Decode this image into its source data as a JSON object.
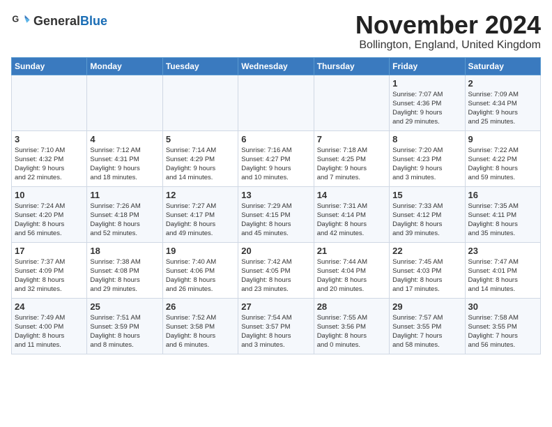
{
  "logo": {
    "general": "General",
    "blue": "Blue"
  },
  "title": "November 2024",
  "location": "Bollington, England, United Kingdom",
  "weekdays": [
    "Sunday",
    "Monday",
    "Tuesday",
    "Wednesday",
    "Thursday",
    "Friday",
    "Saturday"
  ],
  "rows": [
    [
      {
        "day": "",
        "detail": ""
      },
      {
        "day": "",
        "detail": ""
      },
      {
        "day": "",
        "detail": ""
      },
      {
        "day": "",
        "detail": ""
      },
      {
        "day": "",
        "detail": ""
      },
      {
        "day": "1",
        "detail": "Sunrise: 7:07 AM\nSunset: 4:36 PM\nDaylight: 9 hours\nand 29 minutes."
      },
      {
        "day": "2",
        "detail": "Sunrise: 7:09 AM\nSunset: 4:34 PM\nDaylight: 9 hours\nand 25 minutes."
      }
    ],
    [
      {
        "day": "3",
        "detail": "Sunrise: 7:10 AM\nSunset: 4:32 PM\nDaylight: 9 hours\nand 22 minutes."
      },
      {
        "day": "4",
        "detail": "Sunrise: 7:12 AM\nSunset: 4:31 PM\nDaylight: 9 hours\nand 18 minutes."
      },
      {
        "day": "5",
        "detail": "Sunrise: 7:14 AM\nSunset: 4:29 PM\nDaylight: 9 hours\nand 14 minutes."
      },
      {
        "day": "6",
        "detail": "Sunrise: 7:16 AM\nSunset: 4:27 PM\nDaylight: 9 hours\nand 10 minutes."
      },
      {
        "day": "7",
        "detail": "Sunrise: 7:18 AM\nSunset: 4:25 PM\nDaylight: 9 hours\nand 7 minutes."
      },
      {
        "day": "8",
        "detail": "Sunrise: 7:20 AM\nSunset: 4:23 PM\nDaylight: 9 hours\nand 3 minutes."
      },
      {
        "day": "9",
        "detail": "Sunrise: 7:22 AM\nSunset: 4:22 PM\nDaylight: 8 hours\nand 59 minutes."
      }
    ],
    [
      {
        "day": "10",
        "detail": "Sunrise: 7:24 AM\nSunset: 4:20 PM\nDaylight: 8 hours\nand 56 minutes."
      },
      {
        "day": "11",
        "detail": "Sunrise: 7:26 AM\nSunset: 4:18 PM\nDaylight: 8 hours\nand 52 minutes."
      },
      {
        "day": "12",
        "detail": "Sunrise: 7:27 AM\nSunset: 4:17 PM\nDaylight: 8 hours\nand 49 minutes."
      },
      {
        "day": "13",
        "detail": "Sunrise: 7:29 AM\nSunset: 4:15 PM\nDaylight: 8 hours\nand 45 minutes."
      },
      {
        "day": "14",
        "detail": "Sunrise: 7:31 AM\nSunset: 4:14 PM\nDaylight: 8 hours\nand 42 minutes."
      },
      {
        "day": "15",
        "detail": "Sunrise: 7:33 AM\nSunset: 4:12 PM\nDaylight: 8 hours\nand 39 minutes."
      },
      {
        "day": "16",
        "detail": "Sunrise: 7:35 AM\nSunset: 4:11 PM\nDaylight: 8 hours\nand 35 minutes."
      }
    ],
    [
      {
        "day": "17",
        "detail": "Sunrise: 7:37 AM\nSunset: 4:09 PM\nDaylight: 8 hours\nand 32 minutes."
      },
      {
        "day": "18",
        "detail": "Sunrise: 7:38 AM\nSunset: 4:08 PM\nDaylight: 8 hours\nand 29 minutes."
      },
      {
        "day": "19",
        "detail": "Sunrise: 7:40 AM\nSunset: 4:06 PM\nDaylight: 8 hours\nand 26 minutes."
      },
      {
        "day": "20",
        "detail": "Sunrise: 7:42 AM\nSunset: 4:05 PM\nDaylight: 8 hours\nand 23 minutes."
      },
      {
        "day": "21",
        "detail": "Sunrise: 7:44 AM\nSunset: 4:04 PM\nDaylight: 8 hours\nand 20 minutes."
      },
      {
        "day": "22",
        "detail": "Sunrise: 7:45 AM\nSunset: 4:03 PM\nDaylight: 8 hours\nand 17 minutes."
      },
      {
        "day": "23",
        "detail": "Sunrise: 7:47 AM\nSunset: 4:01 PM\nDaylight: 8 hours\nand 14 minutes."
      }
    ],
    [
      {
        "day": "24",
        "detail": "Sunrise: 7:49 AM\nSunset: 4:00 PM\nDaylight: 8 hours\nand 11 minutes."
      },
      {
        "day": "25",
        "detail": "Sunrise: 7:51 AM\nSunset: 3:59 PM\nDaylight: 8 hours\nand 8 minutes."
      },
      {
        "day": "26",
        "detail": "Sunrise: 7:52 AM\nSunset: 3:58 PM\nDaylight: 8 hours\nand 6 minutes."
      },
      {
        "day": "27",
        "detail": "Sunrise: 7:54 AM\nSunset: 3:57 PM\nDaylight: 8 hours\nand 3 minutes."
      },
      {
        "day": "28",
        "detail": "Sunrise: 7:55 AM\nSunset: 3:56 PM\nDaylight: 8 hours\nand 0 minutes."
      },
      {
        "day": "29",
        "detail": "Sunrise: 7:57 AM\nSunset: 3:55 PM\nDaylight: 7 hours\nand 58 minutes."
      },
      {
        "day": "30",
        "detail": "Sunrise: 7:58 AM\nSunset: 3:55 PM\nDaylight: 7 hours\nand 56 minutes."
      }
    ]
  ]
}
